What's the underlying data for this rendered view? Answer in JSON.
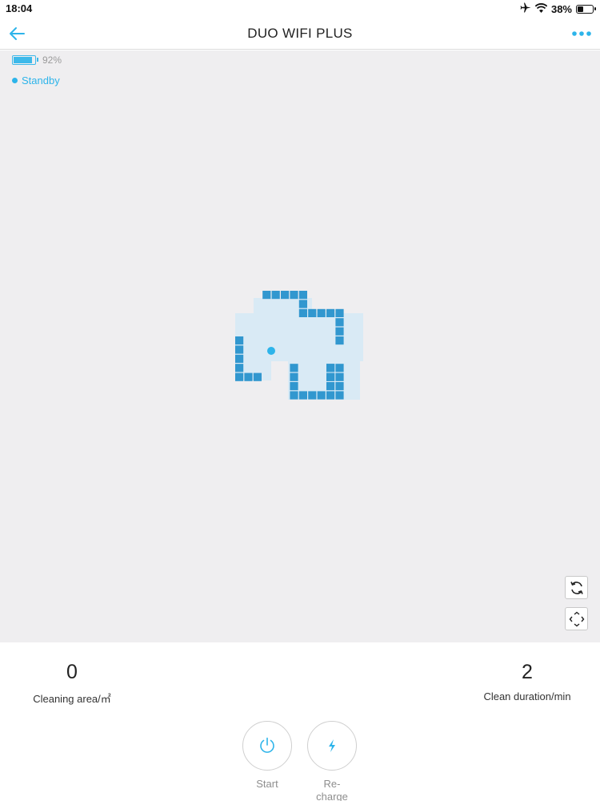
{
  "status_bar": {
    "time": "18:04",
    "battery_percent": "38%",
    "icons": [
      "airplane-icon",
      "wifi-icon",
      "battery-icon"
    ]
  },
  "nav": {
    "title": "DUO WIFI PLUS",
    "back_icon": "arrow-left-icon",
    "more_icon": "more-dots-icon"
  },
  "robot": {
    "battery_percent": "92%",
    "battery_level": 0.92,
    "state": "Standby"
  },
  "map_controls": [
    "rotate-icon",
    "fit-screen-icon"
  ],
  "stats": {
    "area_value": "0",
    "area_label": "Cleaning area/㎡",
    "duration_value": "2",
    "duration_label": "Clean duration/min"
  },
  "controls": {
    "start_label": "Start",
    "recharge_label": "Re-\ncharge"
  },
  "colors": {
    "accent": "#2db4ea",
    "wall": "#3197cf",
    "floor": "#d9eaf5",
    "map_background": "#efeef0"
  }
}
